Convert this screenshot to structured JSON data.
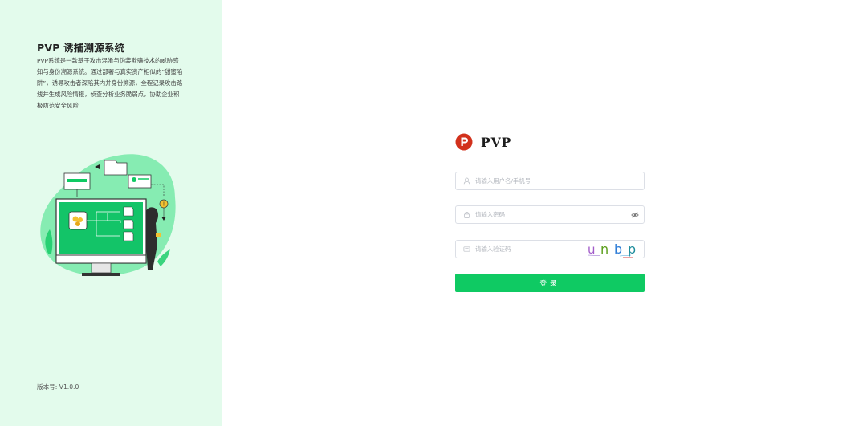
{
  "brand": {
    "title": "PVP 诱捕溯源系统",
    "description": "PVP系统是一款基于攻击混淆与伪装欺骗技术的威胁感知与身份溯源系统。通过部署与真实资产相似的“甜蜜陷阱”，诱导攻击者深陷其内并身份溯源，全程记录攻击路线并生成风险情报，侦查分析业务脆弱点，协助企业积极防范安全风险"
  },
  "version": "版本号: V1.0.0",
  "logo": {
    "text": "PVP",
    "letter": "P"
  },
  "form": {
    "username_placeholder": "请输入用户名/手机号",
    "password_placeholder": "请输入密码",
    "captcha_placeholder": "请输入验证码",
    "captcha_text": [
      "u",
      "n",
      "b",
      "p"
    ],
    "login_label": "登录"
  },
  "colors": {
    "primary": "#0fca63",
    "left_bg": "#e3fbec",
    "logo_red": "#d2311c"
  },
  "icons": {
    "username": "user-icon",
    "password": "lock-icon",
    "captcha": "captcha-icon",
    "toggle": "eye-off-icon"
  }
}
